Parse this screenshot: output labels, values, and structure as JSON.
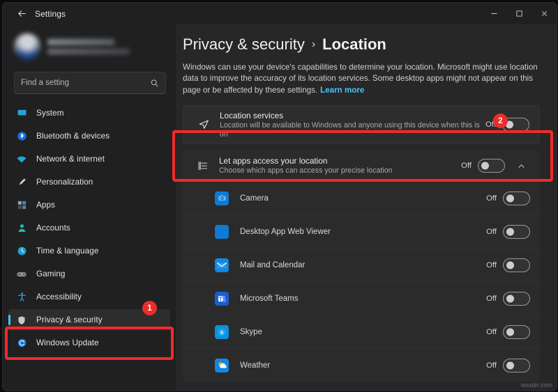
{
  "window": {
    "app_title": "Settings",
    "back_icon": "back-arrow-icon",
    "controls": {
      "minimize": "minimize-icon",
      "maximize": "maximize-icon",
      "close": "close-icon"
    }
  },
  "sidebar": {
    "search": {
      "placeholder": "Find a setting",
      "value": "",
      "icon": "search-icon"
    },
    "items": [
      {
        "label": "System",
        "icon": "system-icon",
        "selected": false
      },
      {
        "label": "Bluetooth & devices",
        "icon": "bluetooth-icon",
        "selected": false
      },
      {
        "label": "Network & internet",
        "icon": "network-icon",
        "selected": false
      },
      {
        "label": "Personalization",
        "icon": "personalization-icon",
        "selected": false
      },
      {
        "label": "Apps",
        "icon": "apps-icon",
        "selected": false
      },
      {
        "label": "Accounts",
        "icon": "accounts-icon",
        "selected": false
      },
      {
        "label": "Time & language",
        "icon": "time-language-icon",
        "selected": false
      },
      {
        "label": "Gaming",
        "icon": "gaming-icon",
        "selected": false
      },
      {
        "label": "Accessibility",
        "icon": "accessibility-icon",
        "selected": false
      },
      {
        "label": "Privacy & security",
        "icon": "shield-icon",
        "selected": true
      },
      {
        "label": "Windows Update",
        "icon": "windows-update-icon",
        "selected": false
      }
    ]
  },
  "main": {
    "breadcrumb": {
      "root": "Privacy & security",
      "separator": "›",
      "leaf": "Location"
    },
    "description": "Windows can use your device's capabilities to determine your location. Microsoft might use location data to improve the accuracy of its location services. Some desktop apps might not appear on this page or be affected by these settings.",
    "learn_more": "Learn more",
    "location_services": {
      "icon": "location-arrow-icon",
      "title": "Location services",
      "subtitle": "Location will be available to Windows and anyone using this device when this is on",
      "toggle_state": "Off",
      "toggle_on": false
    },
    "apps_access": {
      "icon": "list-icon",
      "title": "Let apps access your location",
      "subtitle": "Choose which apps can access your precise location",
      "toggle_state": "Off",
      "toggle_on": false,
      "expanded": true,
      "chevron_icon": "chevron-up-icon"
    },
    "apps": [
      {
        "name": "Camera",
        "icon": "camera-app-icon",
        "toggle_state": "Off",
        "toggle_on": false
      },
      {
        "name": "Desktop App Web Viewer",
        "icon": "desktop-app-web-viewer-icon",
        "toggle_state": "Off",
        "toggle_on": false
      },
      {
        "name": "Mail and Calendar",
        "icon": "mail-calendar-app-icon",
        "toggle_state": "Off",
        "toggle_on": false
      },
      {
        "name": "Microsoft Teams",
        "icon": "microsoft-teams-app-icon",
        "toggle_state": "Off",
        "toggle_on": false
      },
      {
        "name": "Skype",
        "icon": "skype-app-icon",
        "toggle_state": "Off",
        "toggle_on": false
      },
      {
        "name": "Weather",
        "icon": "weather-app-icon",
        "toggle_state": "Off",
        "toggle_on": false
      }
    ]
  },
  "annotations": {
    "badge_1": "1",
    "badge_2": "2",
    "color": "#ec2c2c"
  },
  "watermark": "wsxdn.com"
}
